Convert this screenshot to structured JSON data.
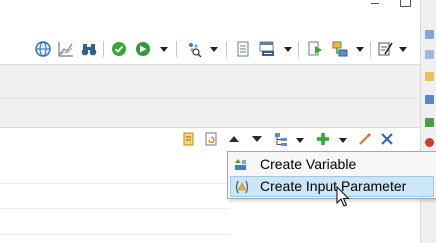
{
  "window": {
    "controls": [
      "minimize-icon",
      "maximize-icon"
    ]
  },
  "main_toolbar": {
    "icons": [
      "globe-icon",
      "chart-icon",
      "binoculars-icon",
      "check-circle-icon",
      "run-arrow-icon",
      "sparkle-search-icon",
      "document-icon",
      "xml-icon",
      "export-icon",
      "connection-icon",
      "edit-document-icon"
    ],
    "accent_green": "#3aa635"
  },
  "view_toolbar": {
    "icons": [
      "note-icon",
      "refresh-document-icon",
      "move-up-icon",
      "move-down-icon",
      "tree-icon",
      "add-icon",
      "pencil-icon",
      "delete-icon"
    ]
  },
  "context_menu": {
    "items": [
      {
        "label": "Create Variable",
        "icon": "variable-icon",
        "highlighted": false
      },
      {
        "label": "Create Input Parameter",
        "icon": "input-parameter-icon",
        "highlighted": true
      }
    ],
    "highlight_color": "#cde6f7",
    "highlight_border": "#99c9ec"
  }
}
